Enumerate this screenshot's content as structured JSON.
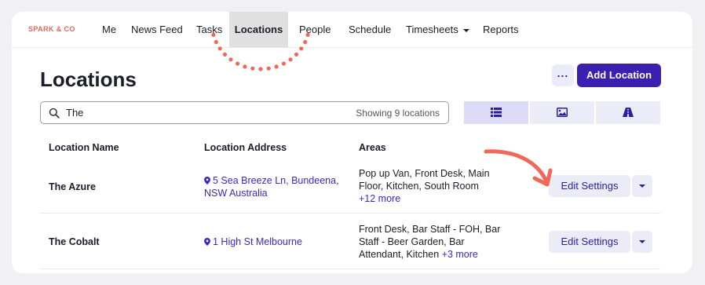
{
  "brand": "SPARK & CO",
  "nav": {
    "items": [
      {
        "label": "Me"
      },
      {
        "label": "News Feed"
      },
      {
        "label": "Tasks"
      },
      {
        "label": "Locations"
      },
      {
        "label": "People"
      },
      {
        "label": "Schedule"
      },
      {
        "label": "Timesheets"
      },
      {
        "label": "Reports"
      }
    ],
    "active": "Locations"
  },
  "header": {
    "title": "Locations",
    "more_label": "...",
    "add_label": "Add Location"
  },
  "search": {
    "value": "The",
    "count_text": "Showing 9 locations"
  },
  "view_toggles": [
    "list-icon",
    "image-icon",
    "map-icon"
  ],
  "table": {
    "headers": [
      "Location Name",
      "Location Address",
      "Areas"
    ],
    "rows": [
      {
        "name": "The Azure",
        "address": "5 Sea Breeze Ln, Bundeena, NSW Australia",
        "areas": "Pop up Van, Front Desk, Main Floor, Kitchen, South Room",
        "areas_more": "+12 more",
        "action": "Edit Settings"
      },
      {
        "name": "The Cobalt",
        "address": "1 High St Melbourne",
        "areas": "Front Desk, Bar Staff - FOH, Bar Staff - Beer Garden, Bar Attendant, Kitchen",
        "areas_more": "+3 more",
        "action": "Edit Settings"
      }
    ]
  },
  "colors": {
    "brand": "#e2665a",
    "accent": "#3a1fb0",
    "link": "#3a2abf",
    "annotation": "#f0685a"
  }
}
